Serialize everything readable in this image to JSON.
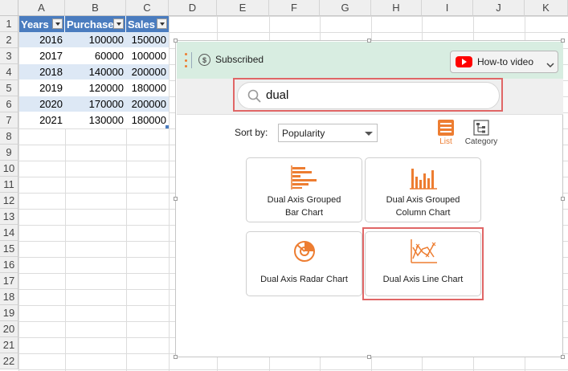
{
  "sheet": {
    "columns": [
      "A",
      "B",
      "C",
      "D",
      "E",
      "F",
      "G",
      "H",
      "I",
      "J",
      "K"
    ],
    "rows": [
      "1",
      "2",
      "3",
      "4",
      "5",
      "6",
      "7",
      "8",
      "9",
      "10",
      "11",
      "12",
      "13",
      "14",
      "15",
      "16",
      "17",
      "18",
      "19",
      "20",
      "21",
      "22"
    ],
    "table": {
      "headers": [
        "Years",
        "Purchase",
        "Sales"
      ],
      "data": [
        [
          "2016",
          "100000",
          "150000"
        ],
        [
          "2017",
          "60000",
          "100000"
        ],
        [
          "2018",
          "140000",
          "200000"
        ],
        [
          "2019",
          "120000",
          "180000"
        ],
        [
          "2020",
          "170000",
          "200000"
        ],
        [
          "2021",
          "130000",
          "180000"
        ]
      ]
    }
  },
  "panel": {
    "status_label": "Subscribed",
    "howto_label": "How-to video",
    "search": {
      "value": "dual",
      "placeholder": "Search"
    },
    "sort": {
      "label": "Sort by:",
      "selected": "Popularity"
    },
    "views": {
      "list_label": "List",
      "category_label": "Category",
      "active": "List"
    },
    "cards": [
      {
        "label_line1": "Dual Axis Grouped",
        "label_line2": "Bar Chart"
      },
      {
        "label_line1": "Dual Axis Grouped",
        "label_line2": "Column Chart"
      },
      {
        "label_line1": "Dual Axis Radar Chart",
        "label_line2": ""
      },
      {
        "label_line1": "Dual Axis Line Chart",
        "label_line2": ""
      }
    ]
  },
  "colors": {
    "accent": "#ed7d31",
    "highlight": "#e06666",
    "table_header": "#4a7cbf",
    "table_band": "#dde8f5",
    "panel_top": "#d8ede1",
    "youtube": "#ff0000"
  }
}
